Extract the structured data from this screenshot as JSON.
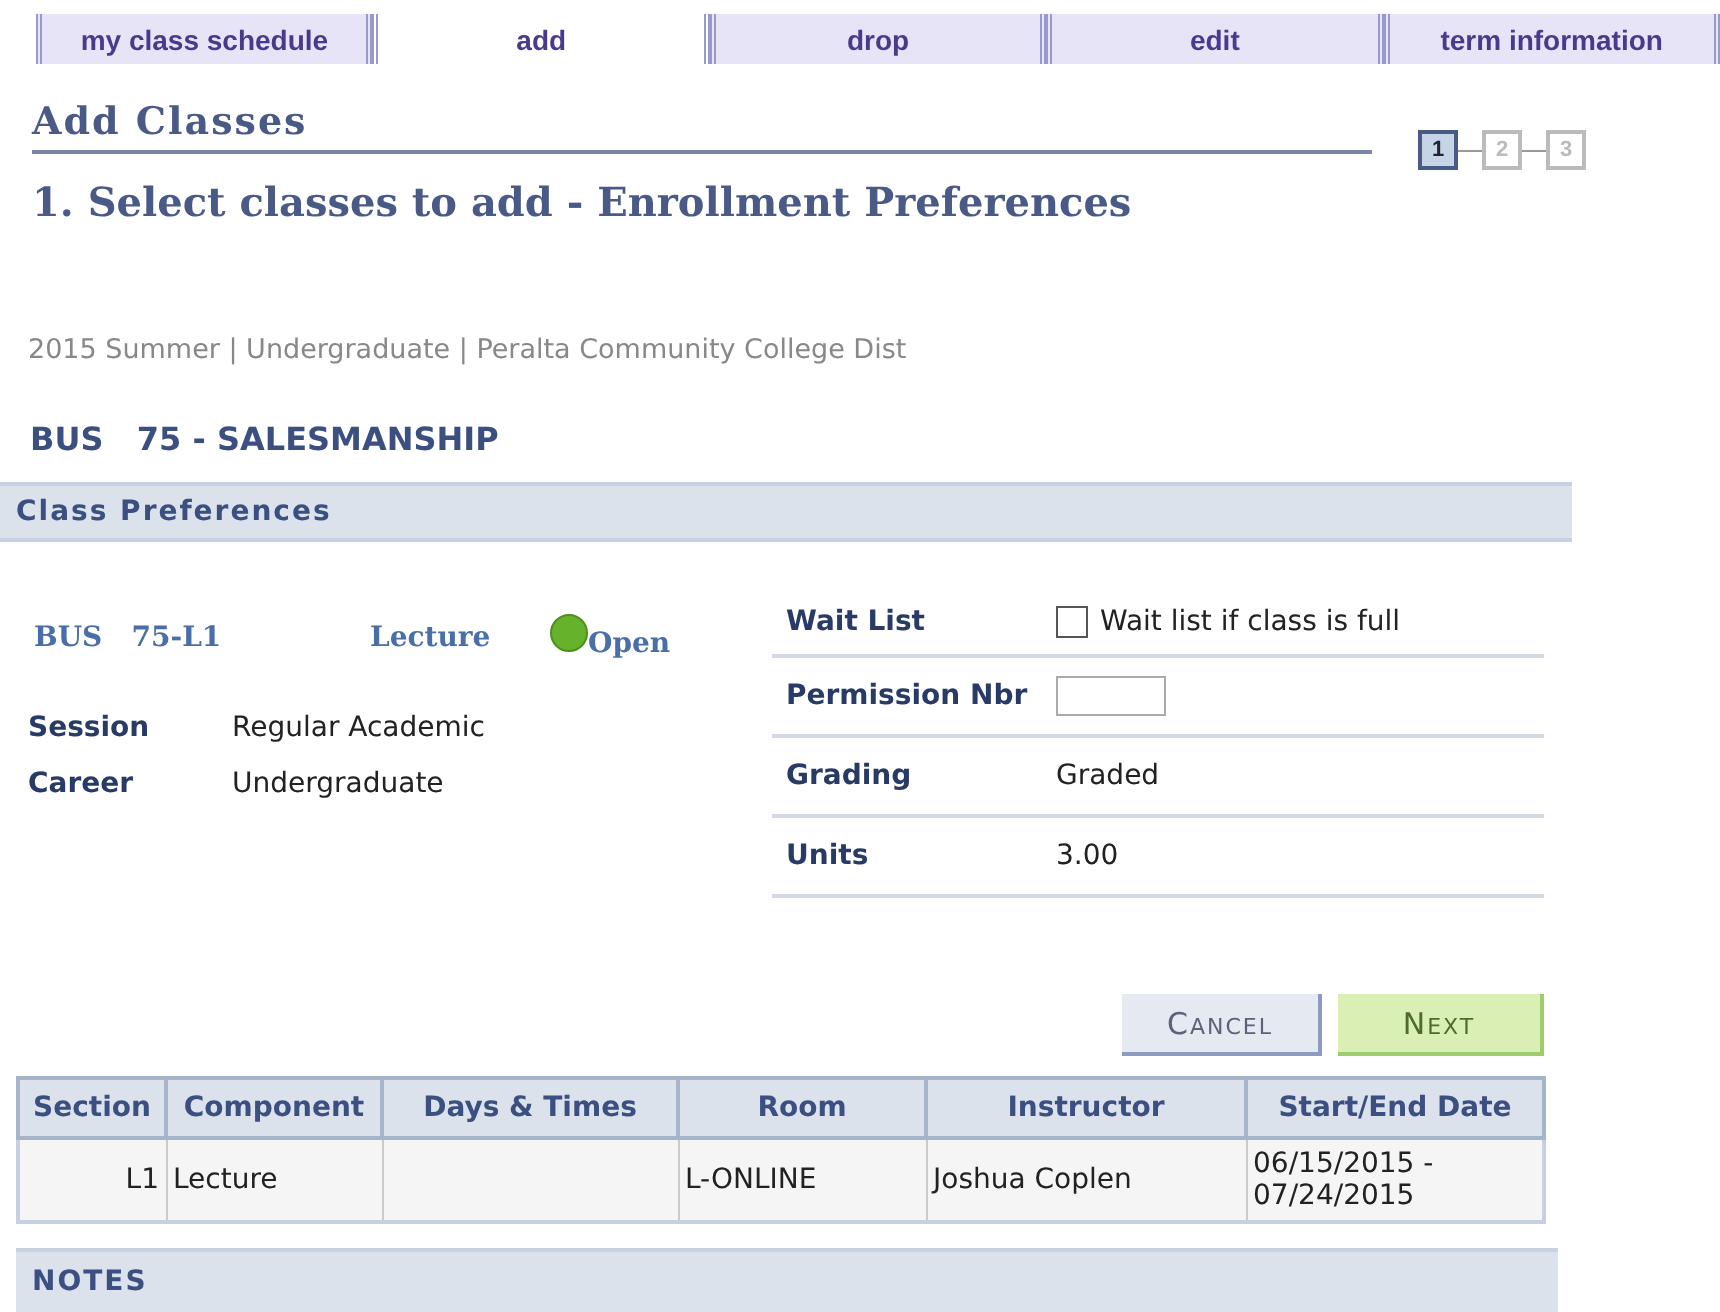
{
  "tabs": [
    {
      "label": "my class schedule",
      "selected": false
    },
    {
      "label": "add",
      "selected": true
    },
    {
      "label": "drop",
      "selected": false
    },
    {
      "label": "edit",
      "selected": false
    },
    {
      "label": "term information",
      "selected": false
    }
  ],
  "page_title": "Add Classes",
  "steps": [
    {
      "label": "1",
      "selected": true
    },
    {
      "label": "2",
      "selected": false
    },
    {
      "label": "3",
      "selected": false
    }
  ],
  "step_title": "1.  Select classes to add - Enrollment Preferences",
  "term_line": "2015 Summer | Undergraduate | Peralta Community College Dist",
  "course_title": "BUS   75 - SALESMANSHIP",
  "section_header": "Class Preferences",
  "class_info": {
    "section": "BUS   75-L1",
    "component": "Lecture",
    "status": "Open",
    "color": "#66b22a"
  },
  "details": [
    {
      "label": "Session",
      "value": "Regular Academic"
    },
    {
      "label": "Career",
      "value": "Undergraduate"
    }
  ],
  "preferences": [
    {
      "kind": "checkbox",
      "label": "Wait List",
      "text": "Wait list if class is full",
      "checked": false
    },
    {
      "kind": "input",
      "label": "Permission Nbr"
    },
    {
      "kind": "text",
      "label": "Grading",
      "value": "Graded"
    },
    {
      "kind": "text",
      "label": "Units",
      "value": "3.00"
    }
  ],
  "buttons": [
    {
      "label": "Cancel",
      "kind": "secondary"
    },
    {
      "label": "Next",
      "kind": "primary"
    }
  ],
  "table": {
    "columns": [
      "Section",
      "Component",
      "Days & Times",
      "Room",
      "Instructor",
      "Start/End Date"
    ],
    "rows": [
      [
        "L1",
        "Lecture",
        "",
        "L-ONLINE",
        "Joshua Coplen",
        "06/15/2015 - 07/24/2015"
      ]
    ]
  },
  "notes_header": "NOTES"
}
